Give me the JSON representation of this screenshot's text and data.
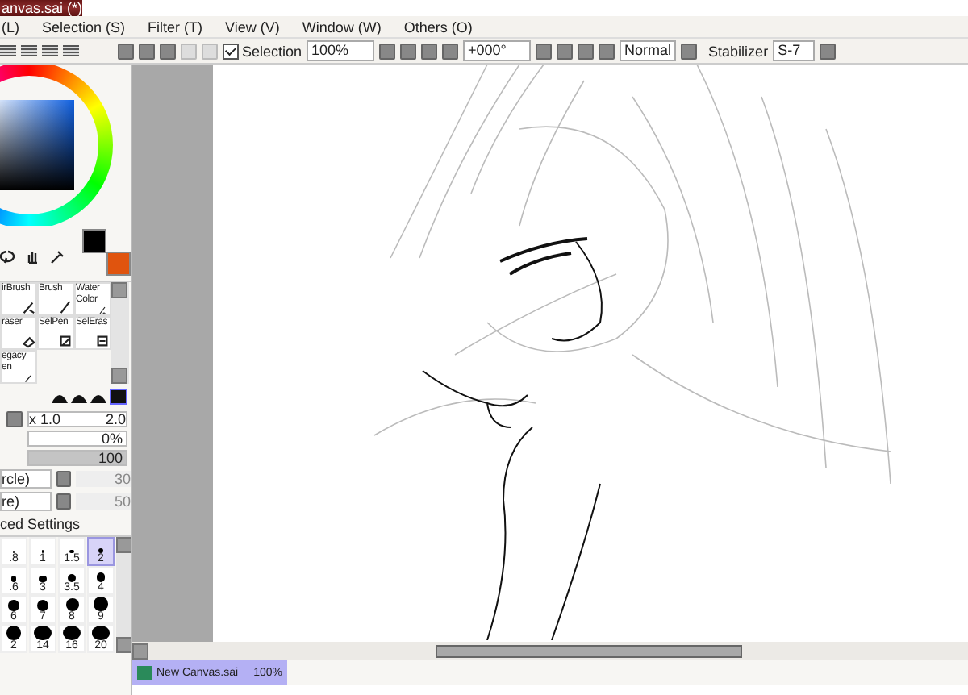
{
  "window": {
    "title": "anvas.sai (*)"
  },
  "menu": [
    {
      "label": "(L)"
    },
    {
      "label": "Selection (S)"
    },
    {
      "label": "Filter (T)"
    },
    {
      "label": "View (V)"
    },
    {
      "label": "Window (W)"
    },
    {
      "label": "Others (O)"
    }
  ],
  "toolbar": {
    "selection": {
      "label": "Selection",
      "checked": true
    },
    "zoom": "100%",
    "rotation": "+000°",
    "blend_mode": "Normal",
    "stabilizer_label": "Stabilizer",
    "stabilizer": "S-7"
  },
  "tools": [
    {
      "label": "irBrush",
      "selected": false
    },
    {
      "label": "Brush",
      "selected": false
    },
    {
      "label": "Water Color",
      "selected": false
    },
    {
      "label": "raser",
      "selected": false
    },
    {
      "label": "SelPen",
      "selected": false
    },
    {
      "label": "SelEras",
      "selected": false
    },
    {
      "label": "egacy en",
      "selected": false
    }
  ],
  "brush": {
    "size_multiplier": "x 1.0",
    "size": "2.0",
    "min_size": {
      "reading": "0%",
      "level": 0
    },
    "density": {
      "reading": "100",
      "level": 1
    },
    "shape": "rcle)",
    "shape_value": "30",
    "texture": "re)",
    "texture_value": "50",
    "advanced_label": "ced Settings"
  },
  "brush_sizes": [
    {
      "label": ".8",
      "selected": false
    },
    {
      "label": "1",
      "selected": false
    },
    {
      "label": "1.5",
      "selected": false
    },
    {
      "label": "2",
      "selected": true
    },
    {
      "label": ".6",
      "selected": false
    },
    {
      "label": "3",
      "selected": false
    },
    {
      "label": "3.5",
      "selected": false
    },
    {
      "label": "4",
      "selected": false
    },
    {
      "label": "6",
      "selected": false
    },
    {
      "label": "7",
      "selected": false
    },
    {
      "label": "8",
      "selected": false
    },
    {
      "label": "9",
      "selected": false
    },
    {
      "label": "2",
      "selected": false
    },
    {
      "label": "14",
      "selected": false
    },
    {
      "label": "16",
      "selected": false
    },
    {
      "label": "20",
      "selected": false
    }
  ],
  "taskbar": [
    {
      "label": "New Canvas.sai",
      "zoom": "100%",
      "selected": true
    }
  ]
}
